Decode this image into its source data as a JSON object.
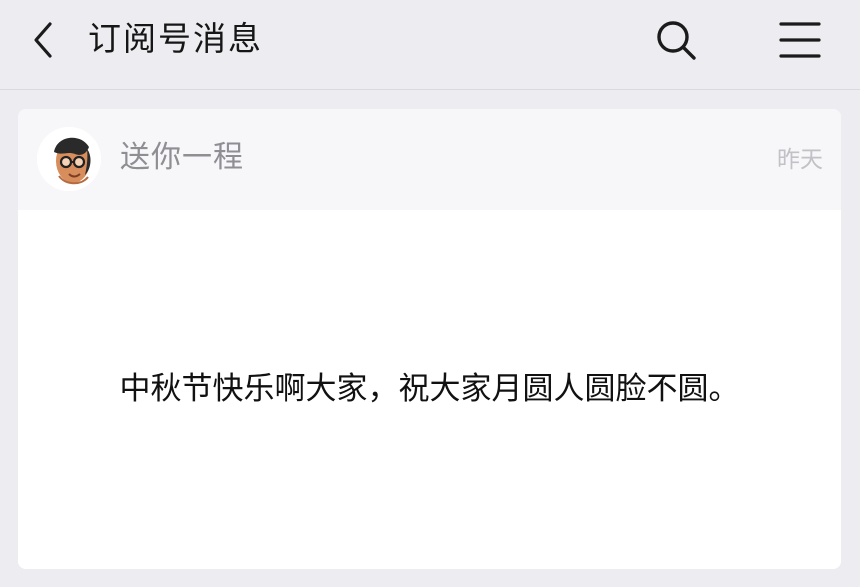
{
  "header": {
    "title": "订阅号消息",
    "back_icon": "chevron-left-icon",
    "search_icon": "search-icon",
    "menu_icon": "menu-icon"
  },
  "message": {
    "sender": "送你一程",
    "time": "昨天",
    "avatar_icon": "avatar",
    "text": "中秋节快乐啊大家，祝大家月圆人圆脸不圆。"
  }
}
